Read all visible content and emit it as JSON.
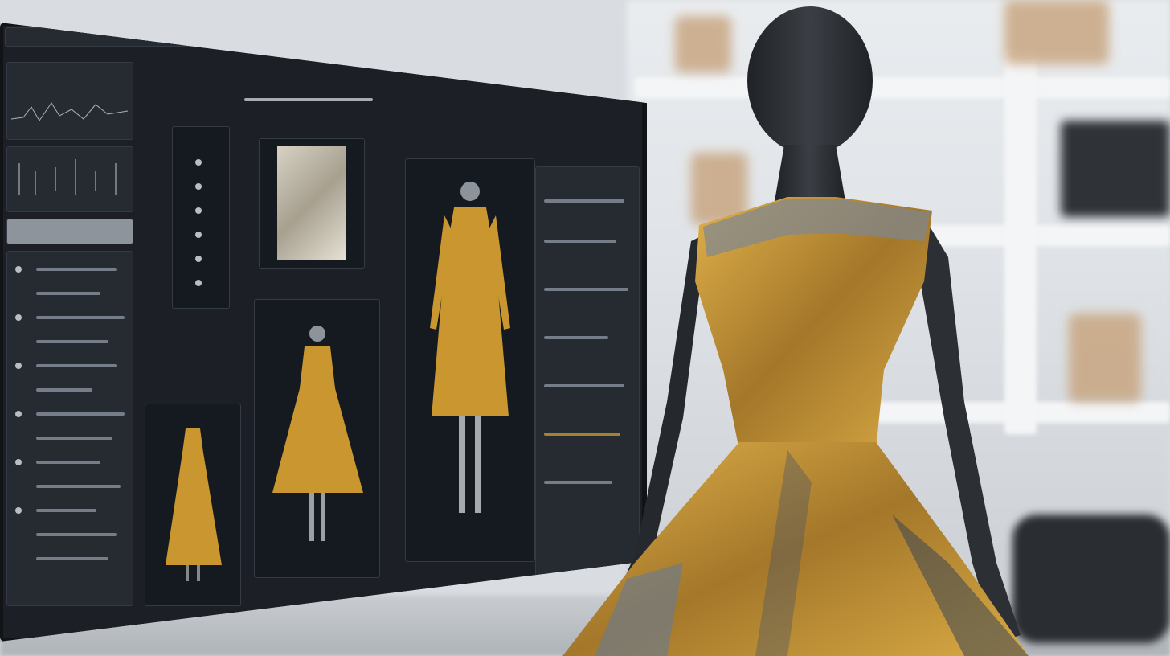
{
  "scene": {
    "description_tags": [
      "monitor-icon",
      "mannequin-icon",
      "dress-icon"
    ],
    "colors": {
      "gold": "#c9962f",
      "screen_bg": "#1c2026",
      "mannequin": "#2b2e33",
      "shelf": "#f4f5f6"
    }
  },
  "monitor": {
    "sidebar_labels": [
      "",
      "",
      ""
    ]
  }
}
